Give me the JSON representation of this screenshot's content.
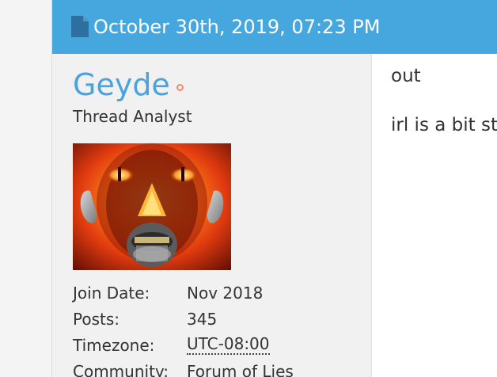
{
  "post": {
    "date": "October 30th, 2019, 07:23 PM",
    "icon": "document-icon",
    "body_lines": [
      "out",
      "irl is a bit st"
    ]
  },
  "user": {
    "name": "Geyde",
    "status": "offline",
    "status_color": "#f4876f",
    "title": "Thread Analyst",
    "info": [
      {
        "label": "Join Date:",
        "value": "Nov 2018"
      },
      {
        "label": "Posts:",
        "value": "345"
      },
      {
        "label": "Timezone:",
        "value": "UTC-08:00"
      },
      {
        "label": "Community:",
        "value": "Forum of Lies"
      }
    ]
  },
  "colors": {
    "header": "#46a6de",
    "username": "#4aa3dd",
    "panel": "#f1f1f1"
  }
}
